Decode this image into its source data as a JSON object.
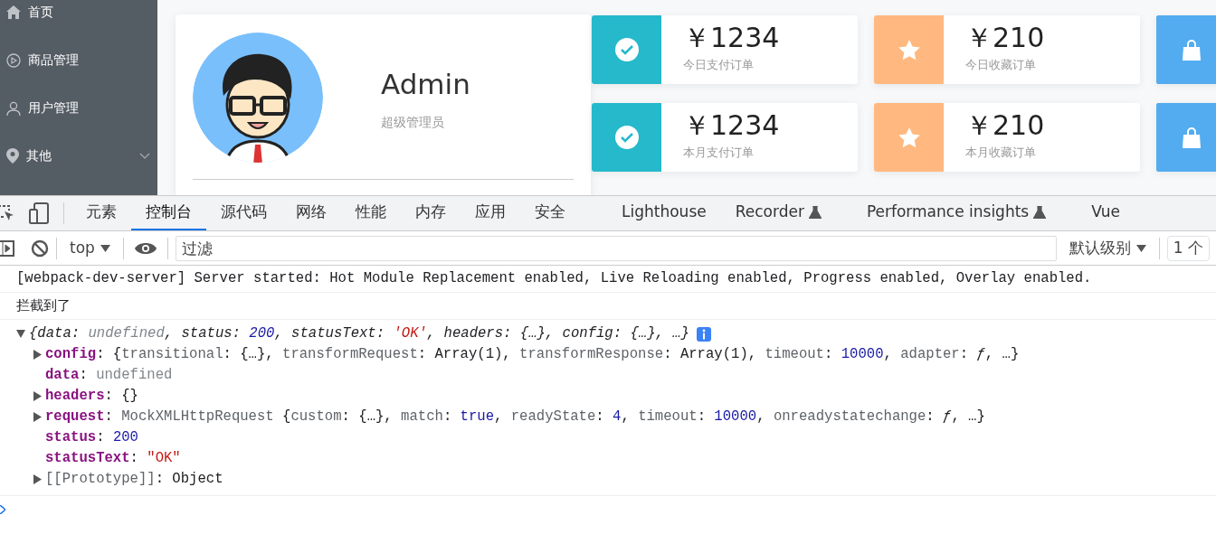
{
  "sidebar": {
    "items": [
      {
        "label": "首页",
        "kind": "home",
        "expandable": false
      },
      {
        "label": "商品管理",
        "kind": "play",
        "expandable": false
      },
      {
        "label": "用户管理",
        "kind": "user",
        "expandable": false
      },
      {
        "label": "其他",
        "kind": "pin",
        "expandable": true,
        "expanded": false
      }
    ]
  },
  "user_card": {
    "name": "Admin",
    "role": "超级管理员"
  },
  "stat_cards": [
    {
      "kind": "check",
      "color": "#25b9cb",
      "value": "￥1234",
      "label": "今日支付订单"
    },
    {
      "kind": "star",
      "color": "#ffb980",
      "value": "￥210",
      "label": "今日收藏订单"
    },
    {
      "kind": "bag",
      "color": "#52acef"
    },
    {
      "kind": "check",
      "color": "#25b9cb",
      "value": "￥1234",
      "label": "本月支付订单"
    },
    {
      "kind": "star",
      "color": "#ffb980",
      "value": "￥210",
      "label": "本月收藏订单"
    },
    {
      "kind": "bag",
      "color": "#52acef"
    }
  ],
  "devtools": {
    "tabs": [
      {
        "label": "元素",
        "selected": false,
        "experimental": false
      },
      {
        "label": "控制台",
        "selected": true,
        "experimental": false
      },
      {
        "label": "源代码",
        "selected": false,
        "experimental": false
      },
      {
        "label": "网络",
        "selected": false,
        "experimental": false
      },
      {
        "label": "性能",
        "selected": false,
        "experimental": false
      },
      {
        "label": "内存",
        "selected": false,
        "experimental": false
      },
      {
        "label": "应用",
        "selected": false,
        "experimental": false
      },
      {
        "label": "安全",
        "selected": false,
        "experimental": false
      },
      {
        "label": "Lighthouse",
        "selected": false,
        "experimental": false
      },
      {
        "label": "Recorder",
        "selected": false,
        "experimental": true
      },
      {
        "label": "Performance insights",
        "selected": false,
        "experimental": true
      },
      {
        "label": "Vue",
        "selected": false,
        "experimental": false
      }
    ],
    "context": "top",
    "filter": {
      "placeholder": "过滤"
    },
    "level": "默认级别",
    "issues": "1 个",
    "messages": [
      {
        "kind": "log",
        "text": "[webpack-dev-server] Server started: Hot Module Replacement enabled, Live Reloading enabled, Progress enabled, Overlay enabled."
      },
      {
        "kind": "text",
        "text": "拦截到了"
      },
      {
        "kind": "object",
        "expanded": true,
        "summary": [
          {
            "t": "{data: ",
            "kind": "plain"
          },
          {
            "t": "undefined",
            "kind": "undefined"
          },
          {
            "t": ", status: ",
            "kind": "plain"
          },
          {
            "t": "200",
            "kind": "number"
          },
          {
            "t": ", statusText: ",
            "kind": "plain"
          },
          {
            "t": "'OK'",
            "kind": "string"
          },
          {
            "t": ", headers: {…}, config: {…}, …}",
            "kind": "plain"
          }
        ],
        "properties": [
          {
            "expandable": true,
            "expanded": false,
            "tokens": [
              {
                "t": "config",
                "kind": "key"
              },
              {
                "t": ": {",
                "kind": "plain"
              },
              {
                "t": "transitional",
                "kind": "dim"
              },
              {
                "t": ": {…}, ",
                "kind": "plain"
              },
              {
                "t": "transformRequest",
                "kind": "dim"
              },
              {
                "t": ": Array(1), ",
                "kind": "plain"
              },
              {
                "t": "transformResponse",
                "kind": "dim"
              },
              {
                "t": ": Array(1), ",
                "kind": "plain"
              },
              {
                "t": "timeout",
                "kind": "dim"
              },
              {
                "t": ": ",
                "kind": "plain"
              },
              {
                "t": "10000",
                "kind": "number"
              },
              {
                "t": ", ",
                "kind": "plain"
              },
              {
                "t": "adapter",
                "kind": "dim"
              },
              {
                "t": ": ",
                "kind": "plain"
              },
              {
                "t": "ƒ",
                "kind": "function"
              },
              {
                "t": ", …}",
                "kind": "plain"
              }
            ]
          },
          {
            "expandable": false,
            "tokens": [
              {
                "t": "data",
                "kind": "key"
              },
              {
                "t": ": ",
                "kind": "plain"
              },
              {
                "t": "undefined",
                "kind": "undefined"
              }
            ]
          },
          {
            "expandable": true,
            "expanded": false,
            "tokens": [
              {
                "t": "headers",
                "kind": "key"
              },
              {
                "t": ": {}",
                "kind": "plain"
              }
            ]
          },
          {
            "expandable": true,
            "expanded": false,
            "tokens": [
              {
                "t": "request",
                "kind": "key"
              },
              {
                "t": ": ",
                "kind": "plain"
              },
              {
                "t": "MockXMLHttpRequest ",
                "kind": "dim"
              },
              {
                "t": "{",
                "kind": "plain"
              },
              {
                "t": "custom",
                "kind": "dim"
              },
              {
                "t": ": {…}, ",
                "kind": "plain"
              },
              {
                "t": "match",
                "kind": "dim"
              },
              {
                "t": ": ",
                "kind": "plain"
              },
              {
                "t": "true",
                "kind": "number"
              },
              {
                "t": ", ",
                "kind": "plain"
              },
              {
                "t": "readyState",
                "kind": "dim"
              },
              {
                "t": ": ",
                "kind": "plain"
              },
              {
                "t": "4",
                "kind": "number"
              },
              {
                "t": ", ",
                "kind": "plain"
              },
              {
                "t": "timeout",
                "kind": "dim"
              },
              {
                "t": ": ",
                "kind": "plain"
              },
              {
                "t": "10000",
                "kind": "number"
              },
              {
                "t": ", ",
                "kind": "plain"
              },
              {
                "t": "onreadystatechange",
                "kind": "dim"
              },
              {
                "t": ": ",
                "kind": "plain"
              },
              {
                "t": "ƒ",
                "kind": "function"
              },
              {
                "t": ", …}",
                "kind": "plain"
              }
            ]
          },
          {
            "expandable": false,
            "tokens": [
              {
                "t": "status",
                "kind": "key"
              },
              {
                "t": ": ",
                "kind": "plain"
              },
              {
                "t": "200",
                "kind": "number"
              }
            ]
          },
          {
            "expandable": false,
            "tokens": [
              {
                "t": "statusText",
                "kind": "key"
              },
              {
                "t": ": ",
                "kind": "plain"
              },
              {
                "t": "\"OK\"",
                "kind": "string"
              }
            ]
          },
          {
            "expandable": true,
            "expanded": false,
            "tokens": [
              {
                "t": "[[Prototype]]",
                "kind": "dim"
              },
              {
                "t": ": Object",
                "kind": "plain"
              }
            ]
          }
        ]
      }
    ]
  }
}
